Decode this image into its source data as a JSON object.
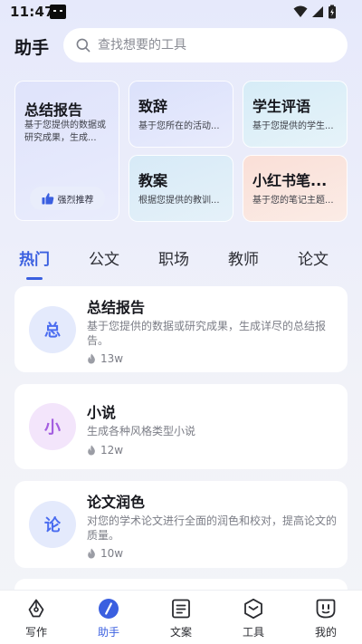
{
  "status_bar": {
    "time": "11:47"
  },
  "header": {
    "title": "助手",
    "search_placeholder": "查找想要的工具"
  },
  "feature_cards": {
    "featured": {
      "title": "总结报告",
      "desc": "基于您提供的数据或研究成果，生成...",
      "recommend_label": "强烈推荐"
    },
    "cards": [
      {
        "title": "致辞",
        "desc": "基于您所在的活动..."
      },
      {
        "title": "学生评语",
        "desc": "基于您提供的学生..."
      },
      {
        "title": "教案",
        "desc": "根据您提供的教训..."
      },
      {
        "title": "小红书笔...",
        "desc": "基于您的笔记主题..."
      }
    ]
  },
  "tabs": [
    {
      "label": "热门",
      "active": true
    },
    {
      "label": "公文",
      "active": false
    },
    {
      "label": "职场",
      "active": false
    },
    {
      "label": "教师",
      "active": false
    },
    {
      "label": "论文",
      "active": false
    }
  ],
  "list": [
    {
      "avatar": "总",
      "title": "总结报告",
      "desc": "基于您提供的数据或研究成果，生成详尽的总结报告。",
      "count": "13w",
      "avatar_bg": "#e4eafc",
      "avatar_color": "#4a6cf0"
    },
    {
      "avatar": "小",
      "title": "小说",
      "desc": "生成各种风格类型小说",
      "count": "12w",
      "avatar_bg": "#f3e5fb",
      "avatar_color": "#a45ee0"
    },
    {
      "avatar": "论",
      "title": "论文润色",
      "desc": "对您的学术论文进行全面的润色和校对，提高论文的质量。",
      "count": "10w",
      "avatar_bg": "#e4eafc",
      "avatar_color": "#4a6cf0"
    }
  ],
  "bottom_nav": [
    {
      "label": "写作",
      "icon": "pen-nib-icon",
      "active": false
    },
    {
      "label": "助手",
      "icon": "assistant-icon",
      "active": true
    },
    {
      "label": "文案",
      "icon": "document-icon",
      "active": false
    },
    {
      "label": "工具",
      "icon": "toolbox-icon",
      "active": false
    },
    {
      "label": "我的",
      "icon": "profile-icon",
      "active": false
    }
  ],
  "colors": {
    "accent": "#3a5fe0",
    "background": "#eceefa"
  }
}
